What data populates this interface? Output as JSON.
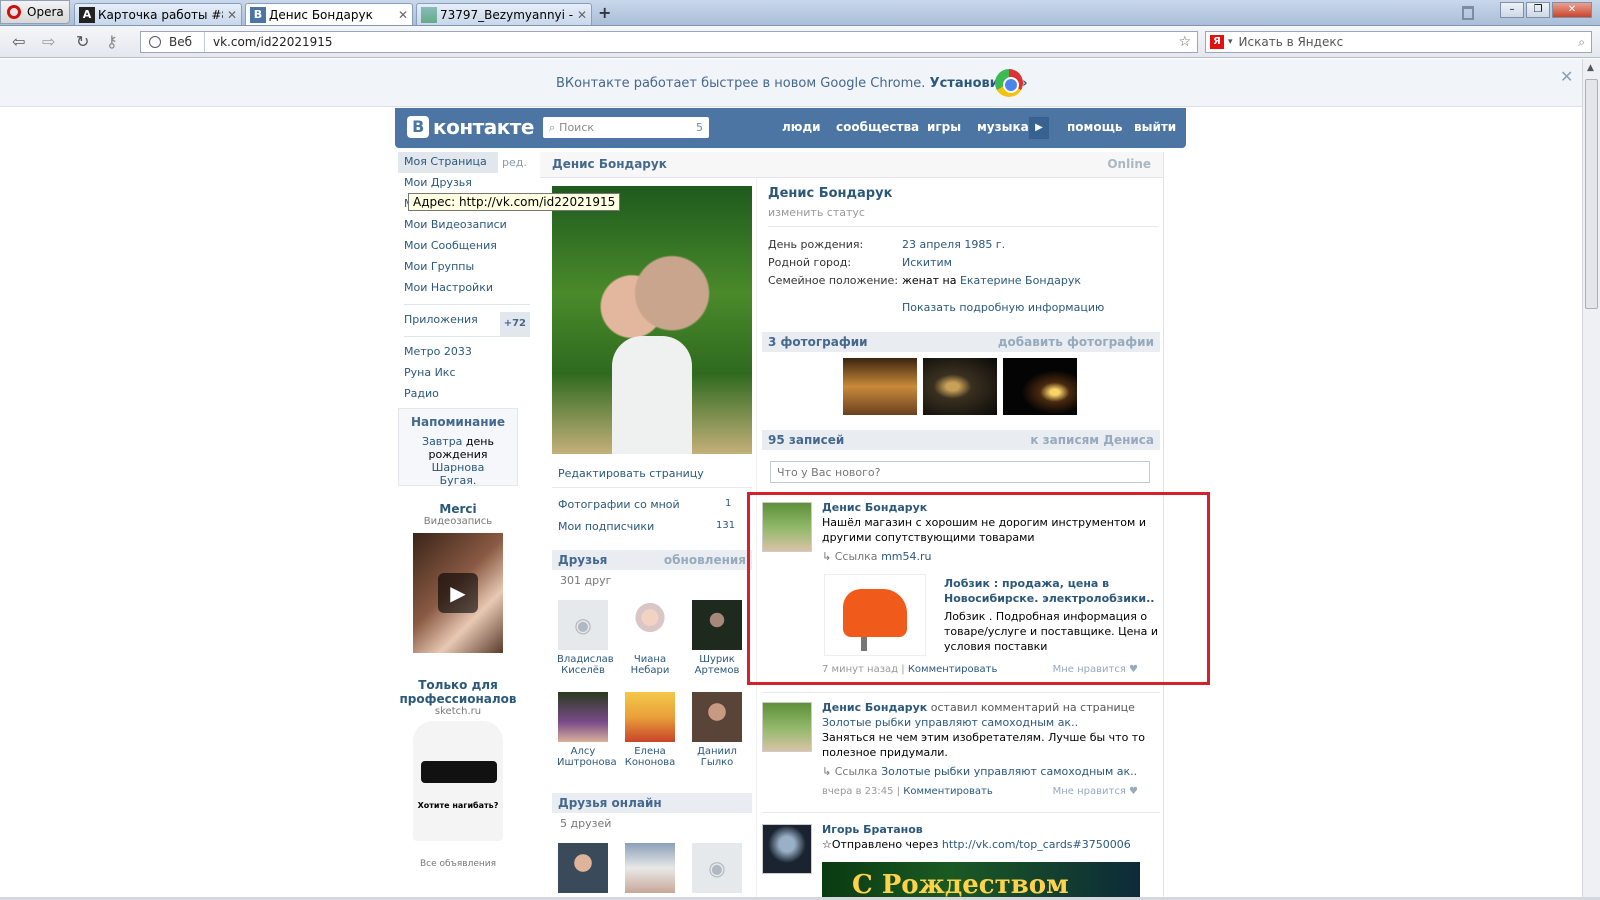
{
  "browser": {
    "opera_label": "Opera",
    "tabs": [
      {
        "icon": "A",
        "title": "Карточка работы #822..."
      },
      {
        "icon": "B",
        "title": "Денис Бондарук"
      },
      {
        "icon": "",
        "title": "73797_Bezymyannyi - 3..."
      }
    ],
    "web_label": "Веб",
    "url": "vk.com/id22021915",
    "search_placeholder": "Искать в Яндекс",
    "tooltip": "Адрес: http://vk.com/id22021915"
  },
  "banner": {
    "text": "ВКонтакте работает быстрее в новом Google Chrome.",
    "install": "Установить »"
  },
  "vk": {
    "logo": "контакте",
    "logo_letter": "В",
    "search_placeholder": "Поиск",
    "search_count": "5",
    "nav": [
      "люди",
      "сообщества",
      "игры",
      "музыка",
      "помощь",
      "выйти"
    ]
  },
  "menu": {
    "my_page": "Моя Страница",
    "edit": "ред.",
    "items": [
      "Мои Друзья",
      "Мои Фотографии",
      "Мои Видеозаписи",
      "Мои Сообщения",
      "Мои Группы",
      "Мои Настройки"
    ],
    "apps": "Приложения",
    "apps_badge": "+72",
    "games": [
      "Метро 2033",
      "Руна Икс",
      "Радио"
    ]
  },
  "reminder": {
    "title": "Напоминание",
    "l1a": "Завтра",
    "l1b": " день",
    "l2a": "рождения ",
    "l2b": "Шарнова",
    "l3": "Бугая."
  },
  "ads": {
    "a1_title": "Merci",
    "a1_sub": "Видеозапись",
    "a2_title": "Только для профессионалов",
    "a2_sub": "sketch.ru",
    "a2_tshirt_text": "Хотите нагибать?",
    "all": "Все объявления"
  },
  "profile": {
    "header_name": "Денис Бондарук",
    "online": "Online",
    "name": "Денис Бондарук",
    "status": "изменить статус",
    "info": [
      {
        "label": "День рождения:",
        "value": "23 апреля 1985 г."
      },
      {
        "label": "Родной город:",
        "value": "Искитим"
      },
      {
        "label": "Семейное положение:",
        "prefix": "женат на ",
        "value": "Екатерине Бондарук"
      }
    ],
    "more": "Показать подробную информацию",
    "edit_page": "Редактировать страницу",
    "photos_with_me": "Фотографии со мной",
    "photos_with_me_count": "1",
    "subscribers": "Мои подписчики",
    "subscribers_count": "131"
  },
  "friends": {
    "title": "Друзья",
    "updates": "обновления",
    "count": "301 друг",
    "list": [
      "Владислав Киселёв",
      "Чиана Небари",
      "Шурик Артемов",
      "Алсу Иштронова",
      "Елена Кононова",
      "Даниил Гылко"
    ],
    "online_title": "Друзья онлайн",
    "online_count": "5 друзей"
  },
  "photos": {
    "title": "3 фотографии",
    "add": "добавить фотографии"
  },
  "wall": {
    "title": "95 записей",
    "to_posts": "к записям Дениса",
    "placeholder": "Что у Вас нового?",
    "post1": {
      "author": "Денис Бондарук",
      "text": "Нашёл магазин с хорошим не дорогим инструментом и другими сопутствующими товарами",
      "link_label": "Ссылка",
      "link": "mm54.ru",
      "attach_title": "Лобзик : продажа, цена в Новосибирске. электролобзики..",
      "attach_desc": "Лобзик . Подробная информация о товаре/услуге и поставщике. Цена и условия поставки",
      "time": "7 минут назад",
      "comment": "Комментировать",
      "like": "Мне нравится"
    },
    "post2": {
      "author": "Денис Бондарук",
      "action": " оставил комментарий на странице",
      "page": "Золотые рыбки управляют самоходным ак..",
      "text": "Заняться не чем этим изобретателям. Лучше бы что то полезное придумали.",
      "link_label": "Ссылка",
      "link": "Золотые рыбки управляют самоходным ак..",
      "time": "вчера в 23:45",
      "comment": "Комментировать",
      "like": "Мне нравится"
    },
    "post3": {
      "author": "Игорь Братанов",
      "text_prefix": "☆Отправлено через ",
      "link": "http://vk.com/top_cards#3750006",
      "image_text": "С Рождеством"
    }
  }
}
